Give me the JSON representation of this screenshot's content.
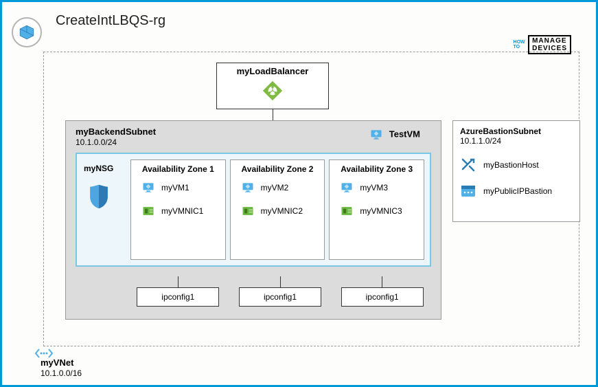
{
  "resourceGroup": {
    "title": "CreateIntLBQS-rg"
  },
  "watermark": {
    "line1": "HOW",
    "line2": "TO",
    "box1": "MANAGE",
    "box2": "DEVICES"
  },
  "loadBalancer": {
    "name": "myLoadBalancer"
  },
  "backendSubnet": {
    "name": "myBackendSubnet",
    "cidr": "10.1.0.0/24"
  },
  "testVM": {
    "name": "TestVM"
  },
  "nsg": {
    "name": "myNSG"
  },
  "zones": [
    {
      "title": "Availability Zone 1",
      "vm": "myVM1",
      "nic": "myVMNIC1",
      "ipconfig": "ipconfig1"
    },
    {
      "title": "Availability Zone 2",
      "vm": "myVM2",
      "nic": "myVMNIC2",
      "ipconfig": "ipconfig1"
    },
    {
      "title": "Availability Zone 3",
      "vm": "myVM3",
      "nic": "myVMNIC3",
      "ipconfig": "ipconfig1"
    }
  ],
  "bastionSubnet": {
    "name": "AzureBastionSubnet",
    "cidr": "10.1.1.0/24",
    "host": "myBastionHost",
    "publicIP": "myPublicIPBastion"
  },
  "vnet": {
    "name": "myVNet",
    "cidr": "10.1.0.0/16"
  }
}
